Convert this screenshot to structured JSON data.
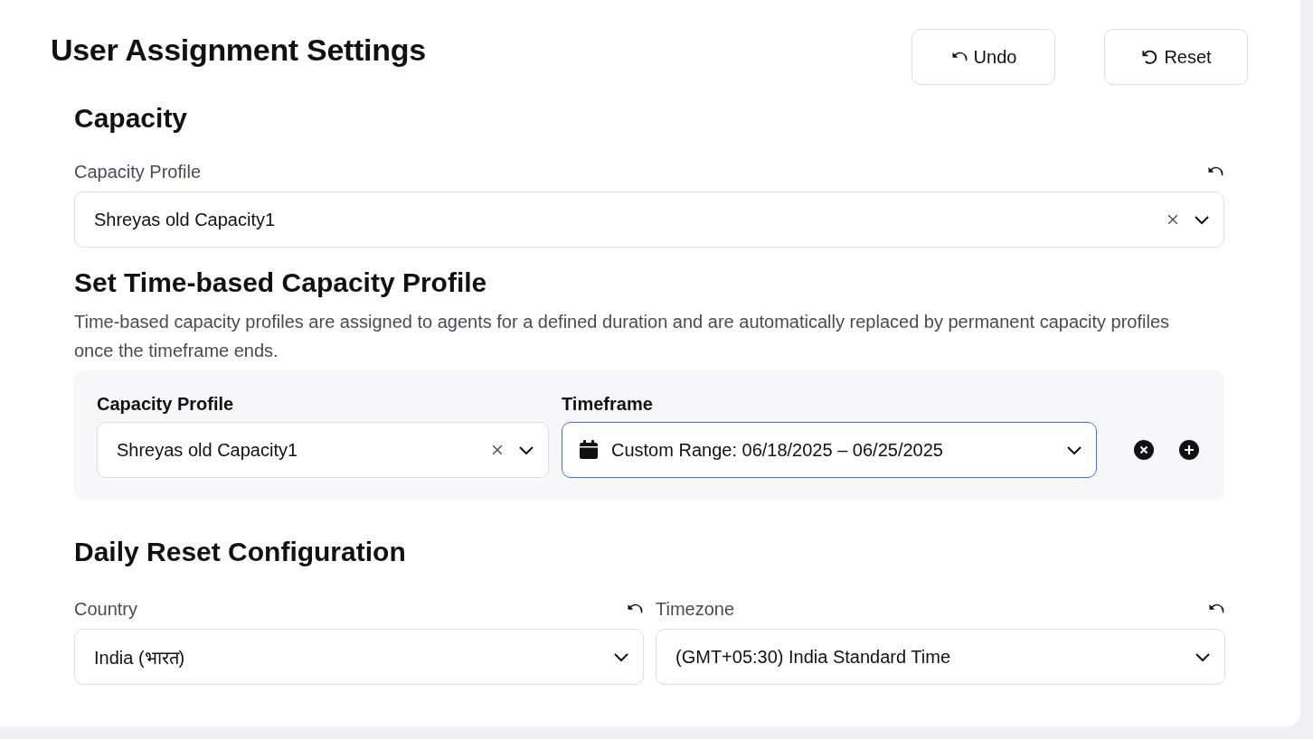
{
  "title": "User Assignment Settings",
  "actions": [
    {
      "label": "Undo",
      "kind": "undo"
    },
    {
      "label": "Reset",
      "kind": "reset"
    }
  ],
  "capacity": {
    "heading": "Capacity",
    "field": {
      "label": "Capacity Profile",
      "value": "Shreyas old Capacity1",
      "clearable": true,
      "resettable": true
    }
  },
  "time_based": {
    "heading": "Set Time-based Capacity Profile",
    "description": "Time-based capacity profiles are assigned to agents for a defined duration and are automatically replaced by permanent capacity profiles once the timeframe ends.",
    "row": {
      "profile": {
        "label": "Capacity Profile",
        "value": "Shreyas old Capacity1",
        "clearable": true,
        "focused": false
      },
      "timeframe": {
        "label": "Timeframe",
        "value": "Custom Range: 06/18/2025 – 06/25/2025",
        "focused": true
      }
    }
  },
  "daily_reset": {
    "heading": "Daily Reset Configuration",
    "fields": [
      {
        "label": "Country",
        "value": "India (भारत)",
        "resettable": true
      },
      {
        "label": "Timezone",
        "value": "(GMT+05:30) India Standard Time",
        "resettable": true
      }
    ]
  }
}
